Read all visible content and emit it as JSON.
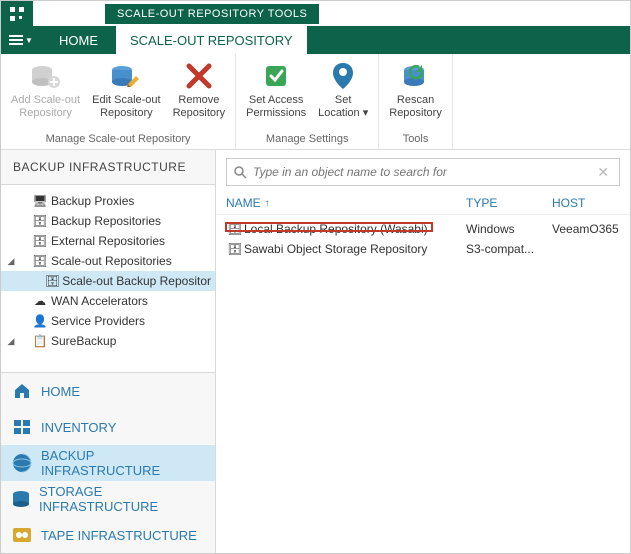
{
  "titlebar": {
    "tools_label": "SCALE-OUT REPOSITORY TOOLS"
  },
  "tabs": {
    "home": "HOME",
    "active": "SCALE-OUT REPOSITORY"
  },
  "ribbon": {
    "group_manage": {
      "label": "Manage Scale-out Repository",
      "add": "Add Scale-out\nRepository",
      "edit": "Edit Scale-out\nRepository",
      "remove": "Remove\nRepository"
    },
    "group_settings": {
      "label": "Manage Settings",
      "access": "Set Access\nPermissions",
      "location": "Set\nLocation ▾"
    },
    "group_tools": {
      "label": "Tools",
      "rescan": "Rescan\nRepository"
    }
  },
  "sidebar": {
    "title": "BACKUP INFRASTRUCTURE",
    "tree": {
      "proxies": "Backup Proxies",
      "repos": "Backup Repositories",
      "external": "External Repositories",
      "scaleout": "Scale-out Repositories",
      "scaleout_child": "Scale-out Backup Repositor",
      "wan": "WAN Accelerators",
      "service": "Service Providers",
      "surebackup": "SureBackup"
    },
    "nav": {
      "home": "HOME",
      "inventory": "INVENTORY",
      "backup_infra": "BACKUP INFRASTRUCTURE",
      "storage_infra": "STORAGE INFRASTRUCTURE",
      "tape_infra": "TAPE INFRASTRUCTURE"
    }
  },
  "search": {
    "placeholder": "Type in an object name to search for"
  },
  "grid": {
    "headers": {
      "name": "NAME",
      "type": "TYPE",
      "host": "HOST"
    },
    "rows": [
      {
        "name": "Local Backup Repository (Wasabi)",
        "type": "Windows",
        "host": "VeeamO365"
      },
      {
        "name": "Sawabi Object Storage Repository",
        "type": "S3-compat...",
        "host": ""
      }
    ]
  }
}
